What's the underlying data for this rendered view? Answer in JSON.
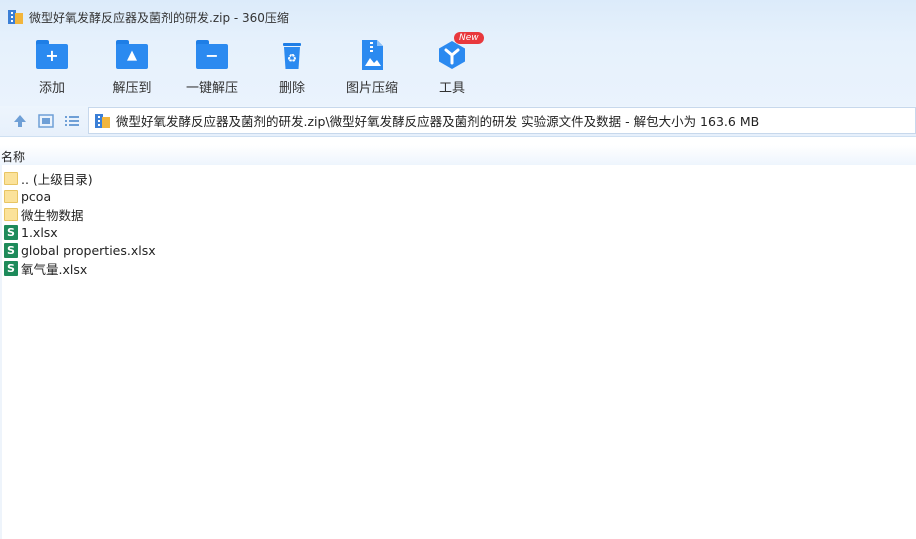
{
  "window": {
    "title": "微型好氧发酵反应器及菌剂的研发.zip - 360压缩"
  },
  "toolbar": {
    "items": [
      {
        "label": "添加",
        "icon": "add-icon"
      },
      {
        "label": "解压到",
        "icon": "extract-to-icon"
      },
      {
        "label": "一键解压",
        "icon": "one-click-extract-icon"
      },
      {
        "label": "删除",
        "icon": "recycle-bin-icon"
      },
      {
        "label": "图片压缩",
        "icon": "image-compress-icon"
      },
      {
        "label": "工具",
        "icon": "tools-icon",
        "badge": "New"
      }
    ]
  },
  "navbar": {
    "path": "微型好氧发酵反应器及菌剂的研发.zip\\微型好氧发酵反应器及菌剂的研发 实验源文件及数据 - 解包大小为 163.6 MB"
  },
  "columns": {
    "name": "名称"
  },
  "files": [
    {
      "name": ".. (上级目录)",
      "type": "folder"
    },
    {
      "name": "pcoa",
      "type": "folder"
    },
    {
      "name": "微生物数据",
      "type": "folder"
    },
    {
      "name": "1.xlsx",
      "type": "xlsx"
    },
    {
      "name": "global properties.xlsx",
      "type": "xlsx"
    },
    {
      "name": "氧气量.xlsx",
      "type": "xlsx"
    }
  ],
  "colors": {
    "accent": "#2b8af0",
    "badge": "#e8383d",
    "excel": "#1d8a5a",
    "folder": "#fbe29a"
  }
}
